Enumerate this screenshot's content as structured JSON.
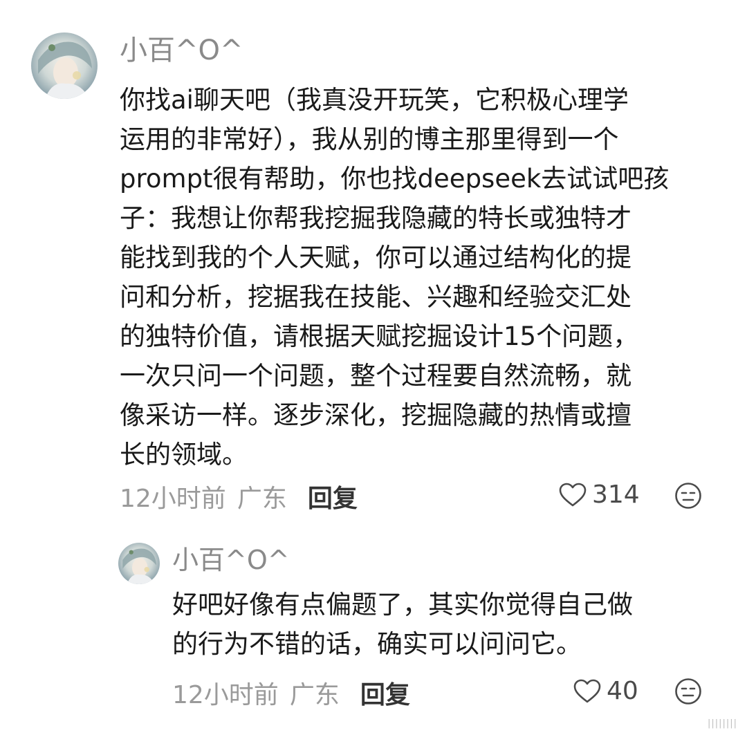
{
  "comment": {
    "username": "小百^O^",
    "avatar": "avatar-anime-girl",
    "text_lines": [
      "你找ai聊天吧（我真没开玩笑，它积极心理学",
      "运用的非常好），我从别的博主那里得到一个",
      "prompt很有帮助，你也找deepseek去试试吧孩",
      "子：我想让你帮我挖掘我隐藏的特长或独特才",
      "能找到我的个人天赋，你可以通过结构化的提",
      "问和分析，挖据我在技能、兴趣和经验交汇处",
      "的独特价值，请根据天赋挖掘设计15个问题，",
      "一次只问一个问题，整个过程要自然流畅，就",
      "像采访一样。逐步深化，挖掘隐藏的热情或擅",
      "长的领域。"
    ],
    "time": "12小时前",
    "region": "广东",
    "reply_label": "回复",
    "like_count": "314",
    "like_icon": "heart-outline-icon",
    "dislike_icon": "neutral-face-icon"
  },
  "reply": {
    "username": "小百^O^",
    "avatar": "avatar-anime-girl",
    "text_lines": [
      "好吧好像有点偏题了，其实你觉得自己做",
      "的行为不错的话，确实可以问问它。"
    ],
    "time": "12小时前",
    "region": "广东",
    "reply_label": "回复",
    "like_count": "40",
    "like_icon": "heart-outline-icon",
    "dislike_icon": "neutral-face-icon"
  },
  "colors": {
    "text": "#1a1a1a",
    "username": "#8a8a8a",
    "meta": "#9a9a9a",
    "icon": "#4a4a4a"
  },
  "watermark": "||||||||"
}
